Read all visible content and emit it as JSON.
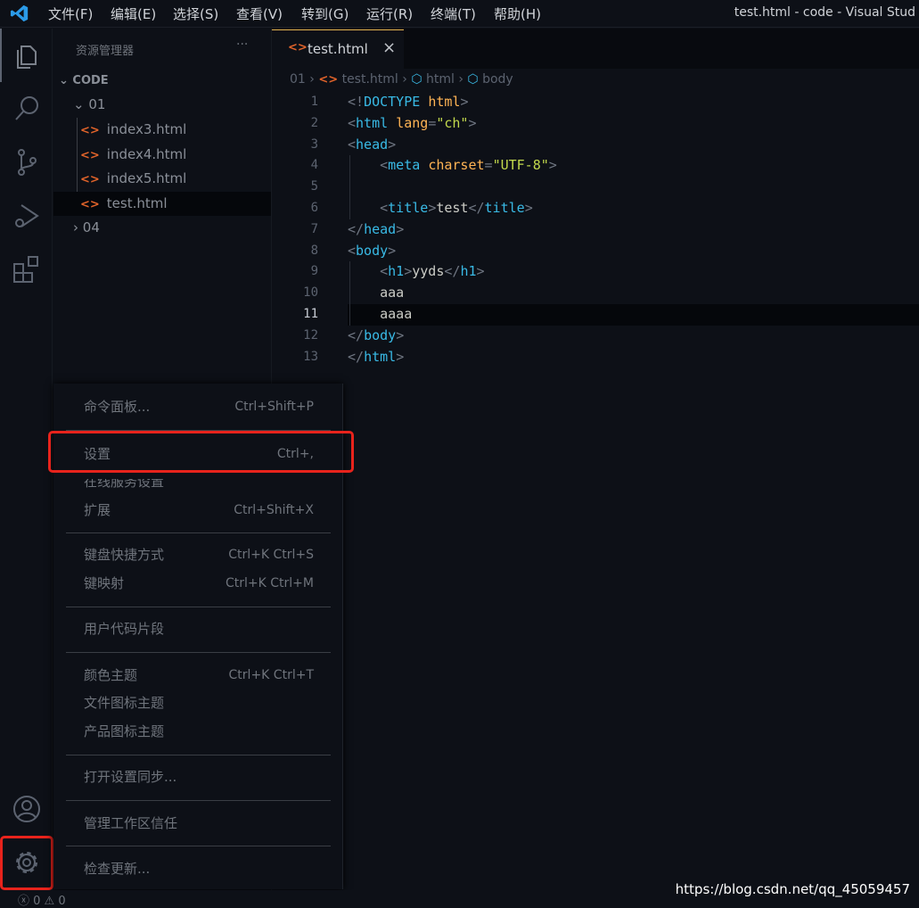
{
  "window_title": "test.html - code - Visual Stud",
  "menubar": [
    "文件(F)",
    "编辑(E)",
    "选择(S)",
    "查看(V)",
    "转到(G)",
    "运行(R)",
    "终端(T)",
    "帮助(H)"
  ],
  "sidebar": {
    "title": "资源管理器",
    "more": "···",
    "root": "CODE",
    "folders": [
      {
        "name": "01",
        "expanded": true,
        "files": [
          "index3.html",
          "index4.html",
          "index5.html",
          "test.html"
        ],
        "selected": "test.html"
      },
      {
        "name": "04",
        "expanded": false
      }
    ]
  },
  "tab": {
    "label": "test.html",
    "close": "×"
  },
  "breadcrumb": [
    "01",
    "test.html",
    "html",
    "body"
  ],
  "editor": {
    "current_line": 11,
    "lines": [
      [
        [
          "p",
          "<!"
        ],
        [
          "t",
          "DOCTYPE"
        ],
        [
          "x",
          " "
        ],
        [
          "a",
          "html"
        ],
        [
          "p",
          ">"
        ]
      ],
      [
        [
          "p",
          "<"
        ],
        [
          "t",
          "html"
        ],
        [
          "x",
          " "
        ],
        [
          "a",
          "lang"
        ],
        [
          "p",
          "="
        ],
        [
          "s",
          "\"ch\""
        ],
        [
          "p",
          ">"
        ]
      ],
      [
        [
          "p",
          "<"
        ],
        [
          "t",
          "head"
        ],
        [
          "p",
          ">"
        ]
      ],
      [
        [
          "x",
          "    "
        ],
        [
          "p",
          "<"
        ],
        [
          "t",
          "meta"
        ],
        [
          "x",
          " "
        ],
        [
          "a",
          "charset"
        ],
        [
          "p",
          "="
        ],
        [
          "s",
          "\"UTF-8\""
        ],
        [
          "p",
          ">"
        ]
      ],
      [],
      [
        [
          "x",
          "    "
        ],
        [
          "p",
          "<"
        ],
        [
          "t",
          "title"
        ],
        [
          "p",
          ">"
        ],
        [
          "x",
          "test"
        ],
        [
          "p",
          "</"
        ],
        [
          "t",
          "title"
        ],
        [
          "p",
          ">"
        ]
      ],
      [
        [
          "p",
          "</"
        ],
        [
          "t",
          "head"
        ],
        [
          "p",
          ">"
        ]
      ],
      [
        [
          "p",
          "<"
        ],
        [
          "t",
          "body"
        ],
        [
          "p",
          ">"
        ]
      ],
      [
        [
          "x",
          "    "
        ],
        [
          "p",
          "<"
        ],
        [
          "t",
          "h1"
        ],
        [
          "p",
          ">"
        ],
        [
          "x",
          "yyds"
        ],
        [
          "p",
          "</"
        ],
        [
          "t",
          "h1"
        ],
        [
          "p",
          ">"
        ]
      ],
      [
        [
          "x",
          "    aaa"
        ]
      ],
      [
        [
          "x",
          "    aaaa"
        ]
      ],
      [
        [
          "p",
          "</"
        ],
        [
          "t",
          "body"
        ],
        [
          "p",
          ">"
        ]
      ],
      [
        [
          "p",
          "</"
        ],
        [
          "t",
          "html"
        ],
        [
          "p",
          ">"
        ]
      ]
    ]
  },
  "context_menu": [
    {
      "label": "命令面板...",
      "key": "Ctrl+Shift+P"
    },
    {
      "label": "设置",
      "key": "Ctrl+,",
      "highlighted": true
    },
    {
      "label": "在线服务设置",
      "key": ""
    },
    {
      "label": "扩展",
      "key": "Ctrl+Shift+X"
    },
    {
      "label": "键盘快捷方式",
      "key": "Ctrl+K Ctrl+S"
    },
    {
      "label": "键映射",
      "key": "Ctrl+K Ctrl+M"
    },
    {
      "label": "用户代码片段",
      "key": ""
    },
    {
      "label": "颜色主题",
      "key": "Ctrl+K Ctrl+T"
    },
    {
      "label": "文件图标主题",
      "key": ""
    },
    {
      "label": "产品图标主题",
      "key": ""
    },
    {
      "label": "打开设置同步...",
      "key": ""
    },
    {
      "label": "管理工作区信任",
      "key": ""
    },
    {
      "label": "检查更新...",
      "key": ""
    }
  ],
  "status": {
    "errors": "0",
    "warnings": "0"
  },
  "watermark": "https://blog.csdn.net/qq_45059457",
  "colors": {
    "highlight": "#e8231c",
    "accent": "#e6b450",
    "html_icon": "#e0632a"
  }
}
